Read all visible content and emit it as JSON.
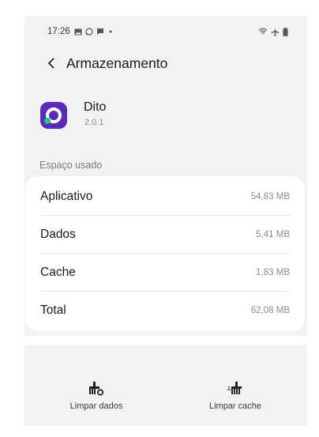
{
  "status_bar": {
    "time": "17:26",
    "icons_left": [
      "gallery-icon",
      "whatsapp-icon",
      "message-icon",
      "dot-icon"
    ],
    "icons_right": [
      "wifi-icon",
      "airplane-icon",
      "battery-icon"
    ]
  },
  "header": {
    "title": "Armazenamento",
    "back_icon": "back-arrow-icon"
  },
  "app": {
    "name": "Dito",
    "version": "2.0.1",
    "icon_color": "#5b2ab8",
    "icon_accent": "#20c48a"
  },
  "section_label": "Espaço usado",
  "storage": [
    {
      "label": "Aplicativo",
      "value": "54,83 MB"
    },
    {
      "label": "Dados",
      "value": "5,41 MB"
    },
    {
      "label": "Cache",
      "value": "1,83 MB"
    },
    {
      "label": "Total",
      "value": "62,08 MB"
    }
  ],
  "actions": {
    "clear_data": "Limpar dados",
    "clear_cache": "Limpar cache"
  }
}
